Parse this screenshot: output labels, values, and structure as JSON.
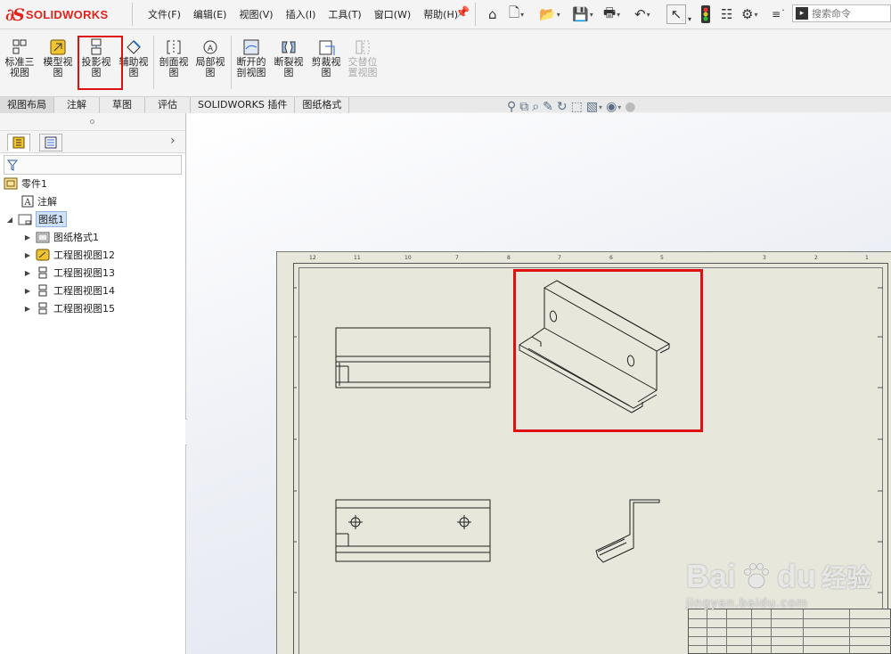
{
  "app": {
    "logo_text": "SOLIDWORKS",
    "menus": [
      "文件(F)",
      "编辑(E)",
      "视图(V)",
      "插入(I)",
      "工具(T)",
      "窗口(W)",
      "帮助(H)"
    ],
    "search_placeholder": "搜索命令"
  },
  "toolbar": {
    "tools": [
      {
        "label": "标准三\n视图",
        "icon": "standard-3-view-icon"
      },
      {
        "label": "模型视\n图",
        "icon": "model-view-icon"
      },
      {
        "label": "投影视\n图",
        "icon": "projected-view-icon"
      },
      {
        "label": "辅助视\n图",
        "icon": "auxiliary-view-icon"
      },
      {
        "label": "剖面视\n图",
        "icon": "section-view-icon"
      },
      {
        "label": "局部视\n图",
        "icon": "detail-view-icon"
      },
      {
        "label": "断开的\n剖视图",
        "icon": "broken-out-section-icon"
      },
      {
        "label": "断裂视\n图",
        "icon": "break-view-icon"
      },
      {
        "label": "剪裁视\n图",
        "icon": "crop-view-icon"
      },
      {
        "label": "交替位\n置视图",
        "icon": "alternate-position-icon",
        "disabled": true
      }
    ]
  },
  "tabs": [
    "视图布局",
    "注解",
    "草图",
    "评估",
    "SOLIDWORKS 插件",
    "图纸格式"
  ],
  "tree": {
    "root": "零件1",
    "annotations": "注解",
    "sheet": "图纸1",
    "children": [
      "图纸格式1",
      "工程图视图12",
      "工程图视图13",
      "工程图视图14",
      "工程图视图15"
    ]
  },
  "sheet": {
    "zones_top": [
      "12",
      "11",
      "10",
      "7",
      "8",
      "7",
      "6",
      "5",
      "3",
      "2",
      "1"
    ]
  },
  "watermark": {
    "brand": "Bai",
    "brand2": "du",
    "jingyan": "经验",
    "url": "jingyan.baidu.com"
  }
}
